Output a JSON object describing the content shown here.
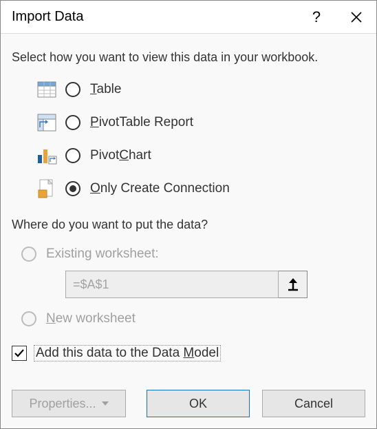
{
  "title": "Import Data",
  "section1_label": "Select how you want to view this data in your workbook.",
  "view_options": {
    "table": {
      "pre": "",
      "u": "T",
      "post": "able",
      "selected": false
    },
    "pivot": {
      "pre": "",
      "u": "P",
      "post": "ivotTable Report",
      "selected": false
    },
    "chart": {
      "pre": "Pivot",
      "u": "C",
      "post": "hart",
      "selected": false
    },
    "conn": {
      "pre": "",
      "u": "O",
      "post": "nly Create Connection",
      "selected": true
    }
  },
  "section2_label": "Where do you want to put the data?",
  "loc_options": {
    "existing": {
      "label": "Existing worksheet:",
      "enabled": false
    },
    "new": {
      "pre": "",
      "u": "N",
      "post": "ew worksheet",
      "enabled": false
    },
    "ref_value": "=$A$1"
  },
  "checkbox": {
    "pre": "Add this data to the Data ",
    "u": "M",
    "post": "odel",
    "checked": true
  },
  "buttons": {
    "properties": "Properties...",
    "ok": "OK",
    "cancel": "Cancel"
  }
}
